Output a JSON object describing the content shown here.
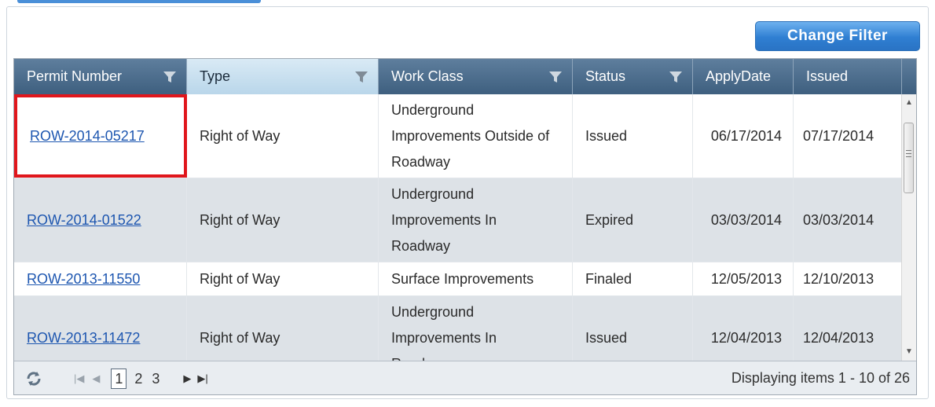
{
  "toolbar": {
    "change_filter_label": "Change Filter"
  },
  "columns": [
    {
      "label": "Permit Number",
      "filter_icon": "funnel-icon",
      "sorted": false
    },
    {
      "label": "Type",
      "filter_icon": "funnel-icon",
      "sorted": true
    },
    {
      "label": "Work Class",
      "filter_icon": "funnel-icon",
      "sorted": false
    },
    {
      "label": "Status",
      "filter_icon": "funnel-icon",
      "sorted": false
    },
    {
      "label": "ApplyDate",
      "sorted": false
    },
    {
      "label": "Issued",
      "sorted": false
    }
  ],
  "rows": [
    {
      "permit": "ROW-2014-05217",
      "type": "Right of Way",
      "work_class": "Underground Improvements Outside of Roadway",
      "status": "Issued",
      "apply_date": "06/17/2014",
      "issued": "07/17/2014",
      "highlighted": true
    },
    {
      "permit": "ROW-2014-01522",
      "type": "Right of Way",
      "work_class": "Underground Improvements In Roadway",
      "status": "Expired",
      "apply_date": "03/03/2014",
      "issued": "03/03/2014"
    },
    {
      "permit": "ROW-2013-11550",
      "type": "Right of Way",
      "work_class": "Surface Improvements",
      "status": "Finaled",
      "apply_date": "12/05/2013",
      "issued": "12/10/2013"
    },
    {
      "permit": "ROW-2013-11472",
      "type": "Right of Way",
      "work_class": "Underground Improvements In Roadway",
      "status": "Issued",
      "apply_date": "12/04/2013",
      "issued": "12/04/2013"
    }
  ],
  "pager": {
    "pages": [
      "1",
      "2",
      "3"
    ],
    "current_page": "1",
    "status_text": "Displaying items 1 - 10 of 26"
  },
  "colors": {
    "header": "#4a6b8b",
    "link": "#1d56b0",
    "highlight_border": "#e0161c",
    "button": "#2f7fd2"
  }
}
